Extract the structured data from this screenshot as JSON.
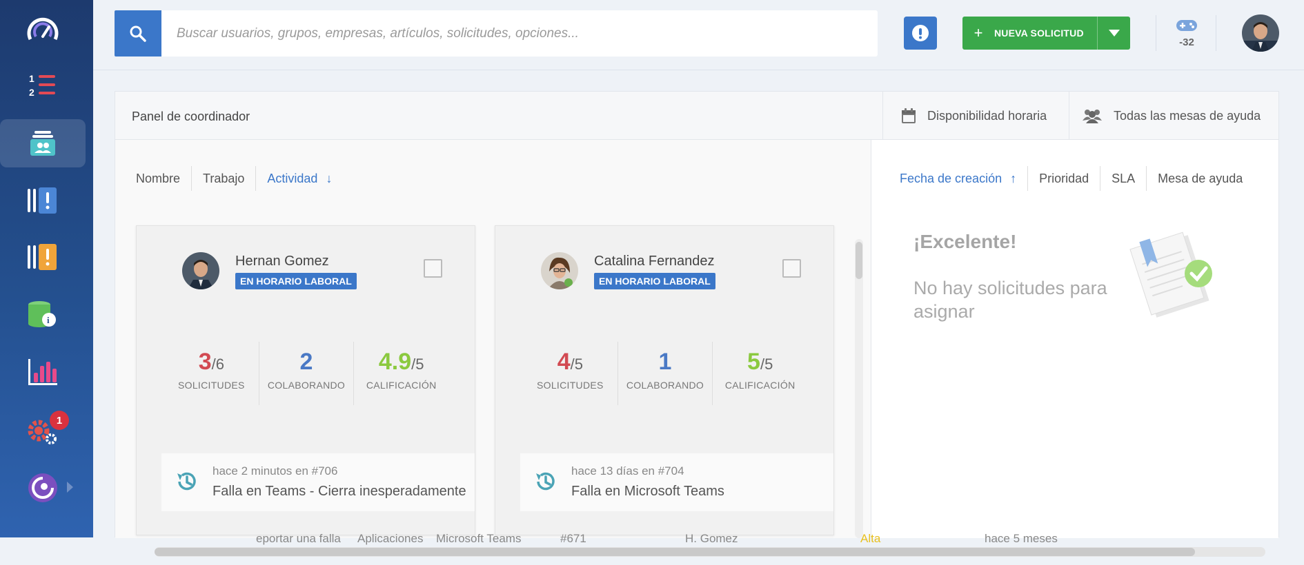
{
  "search": {
    "placeholder": "Buscar usuarios, grupos, empresas, artículos, solicitudes, opciones..."
  },
  "toolbar": {
    "new_request_label": "NUEVA SOLICITUD",
    "game_points": "-32"
  },
  "sidebar": {
    "settings_badge": "1"
  },
  "panel": {
    "title": "Panel de coordinador",
    "tabs": [
      "Disponibilidad horaria",
      "Todas las mesas de ayuda"
    ]
  },
  "left_sort": {
    "items": [
      "Nombre",
      "Trabajo",
      "Actividad"
    ]
  },
  "right_sort": {
    "items": [
      "Fecha de creación",
      "Prioridad",
      "SLA",
      "Mesa de ayuda"
    ]
  },
  "cards": [
    {
      "name": "Hernan Gomez",
      "status": "EN HORARIO LABORAL",
      "requests": "3",
      "requests_total": "/6",
      "collaborating": "2",
      "rating": "4.9",
      "rating_total": "/5",
      "activity_when": "hace 2 minutos en #706",
      "activity_what": "Falla en Teams - Cierra inesperadamente"
    },
    {
      "name": "Catalina Fernandez",
      "status": "EN HORARIO LABORAL",
      "requests": "4",
      "requests_total": "/5",
      "collaborating": "1",
      "rating": "5",
      "rating_total": "/5",
      "activity_when": "hace 13 días en #704",
      "activity_what": "Falla en Microsoft Teams"
    }
  ],
  "stat_labels": {
    "requests": "SOLICITUDES",
    "collaborating": "COLABORANDO",
    "rating": "CALIFICACIÓN"
  },
  "empty": {
    "title": "¡Excelente!",
    "message": "No hay solicitudes para asignar"
  },
  "background_row": {
    "path": [
      "eportar una falla",
      "Aplicaciones",
      "Microsoft Teams"
    ],
    "id": "#671",
    "agent": "H. Gomez",
    "priority": "Alta",
    "time": "hace 5 meses"
  },
  "colors": {
    "accent": "#3b77c9",
    "success": "#3aa84a",
    "danger": "#d9323f"
  }
}
